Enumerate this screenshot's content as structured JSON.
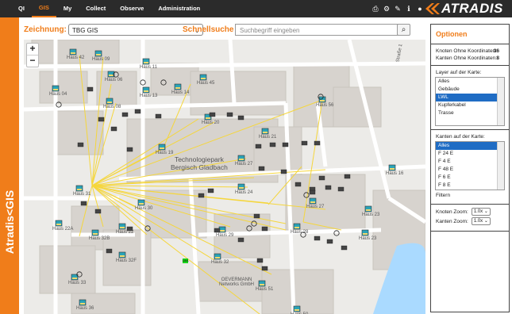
{
  "nav": {
    "items": [
      "QI",
      "GIS",
      "My",
      "Collect",
      "Observe",
      "Administration"
    ],
    "active": "GIS"
  },
  "header_tools": {
    "icons": [
      "print-icon",
      "gear-icon",
      "wrench-icon",
      "info-icon",
      "user-icon"
    ]
  },
  "brand": {
    "name": "ATRADIS"
  },
  "sidebar": {
    "vertical_label": "Atradis<GIS"
  },
  "toolbar": {
    "drawing_label": "Zeichnung:",
    "drawing_value": "TBG GIS",
    "quicksearch_label": "Schnellsuche",
    "search_placeholder": "Suchbegriff eingeben"
  },
  "map": {
    "campus_line1": "Technologiepark",
    "campus_line2": "Bergisch Gladbach",
    "street": "Straße 1",
    "company_line1": "OEVERMANN",
    "company_line2": "Networks GmbH",
    "green_marker": "LWL",
    "houses": [
      {
        "label": "Haus 42"
      },
      {
        "label": "Haus 09"
      },
      {
        "label": "Haus 11"
      },
      {
        "label": "Haus 04"
      },
      {
        "label": "Haus 06"
      },
      {
        "label": "Haus 08"
      },
      {
        "label": "Haus 13"
      },
      {
        "label": "Haus 45"
      },
      {
        "label": "Haus 14"
      },
      {
        "label": "Haus 20"
      },
      {
        "label": "Haus 56"
      },
      {
        "label": "Haus 19"
      },
      {
        "label": "Haus 27"
      },
      {
        "label": "Haus 24"
      },
      {
        "label": "Haus 31"
      },
      {
        "label": "Haus 30"
      },
      {
        "label": "Haus 22A"
      },
      {
        "label": "Haus 32B"
      },
      {
        "label": "Haus 29"
      },
      {
        "label": "Haus 28"
      },
      {
        "label": "Haus 27"
      },
      {
        "label": "Haus 23"
      },
      {
        "label": "Haus 23"
      },
      {
        "label": "Haus 16"
      },
      {
        "label": "Haus 32F"
      },
      {
        "label": "Haus 33"
      },
      {
        "label": "Haus 51"
      },
      {
        "label": "Haus 36"
      },
      {
        "label": "Haus 50"
      },
      {
        "label": "Haus 22"
      },
      {
        "label": "Haus 32"
      },
      {
        "label": "Haus 21"
      }
    ]
  },
  "options": {
    "title": "Optionen",
    "nodes_label": "Knoten Ohne Koordinaten:",
    "nodes_value": "36",
    "edges_label": "Kanten Ohne Koordinaten:",
    "edges_value": "8",
    "layers_label": "Layer auf der Karte:",
    "layers": [
      "Alles",
      "Gebäude",
      "LWL",
      "Kupferkabel",
      "Trasse"
    ],
    "layers_selected": "LWL",
    "edges_map_label": "Kanten auf der Karte:",
    "edges_list": [
      "Alles",
      "F 24 E",
      "F 4 E",
      "F 48 E",
      "F 6 E",
      "F 8 E"
    ],
    "edges_selected": "Alles",
    "filter_label": "Filtern",
    "node_zoom_label": "Knoten Zoom:",
    "node_zoom_value": "1.0x",
    "edge_zoom_label": "Kanten Zoom:",
    "edge_zoom_value": "1.0x"
  }
}
